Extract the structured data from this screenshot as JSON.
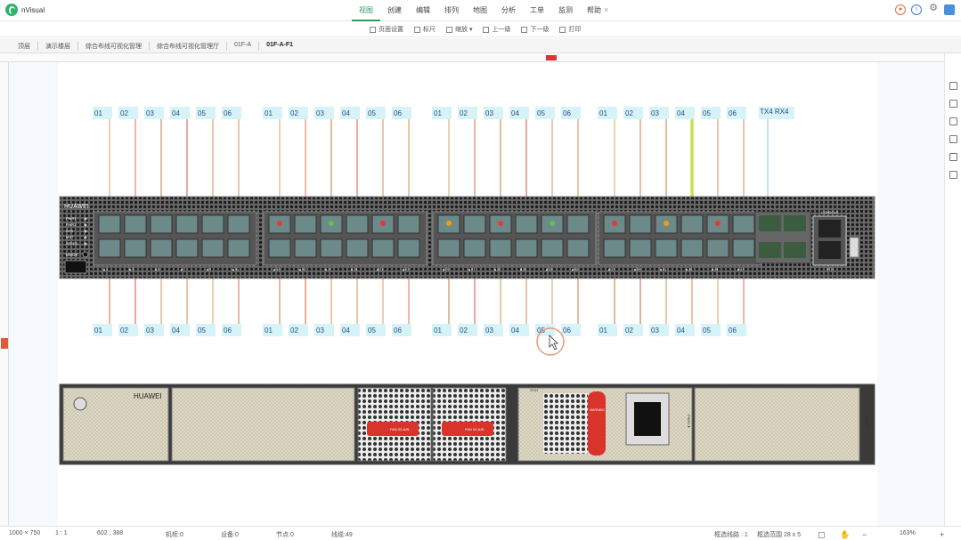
{
  "app": {
    "name": "nVisual"
  },
  "menu": [
    {
      "label": "视图",
      "active": true
    },
    {
      "label": "创建"
    },
    {
      "label": "编辑"
    },
    {
      "label": "排列"
    },
    {
      "label": "地图"
    },
    {
      "label": "分析"
    },
    {
      "label": "工单"
    },
    {
      "label": "监测"
    },
    {
      "label": "帮助"
    }
  ],
  "toolbar": [
    {
      "label": "页面设置"
    },
    {
      "label": "标尺"
    },
    {
      "label": "缩放 ▾"
    },
    {
      "label": "上一级"
    },
    {
      "label": "下一级"
    },
    {
      "label": "打印"
    }
  ],
  "breadcrumb": [
    "顶层",
    "演示楼层",
    "综合布线可视化管理",
    "综合布线可视化管理厅",
    "01F-A",
    "01F-A-F1"
  ],
  "device1": {
    "brand": "HUAWEI",
    "leds": [
      "PWR1",
      "PWR2",
      "SYS",
      "MST",
      "SPEED"
    ],
    "mode_label": "MODE",
    "console_label": "CONSOLE",
    "eth_label": "ETH",
    "port_numbers": [
      "1",
      "3",
      "5",
      "7",
      "9",
      "11",
      "13",
      "15",
      "17",
      "19",
      "21",
      "23",
      "25",
      "27",
      "29",
      "31",
      "33",
      "35",
      "37",
      "39",
      "41",
      "43",
      "45",
      "47"
    ],
    "top_row_numbers": [
      "2",
      "4",
      "6",
      "8",
      "10",
      "12",
      "14",
      "16",
      "18",
      "20",
      "22",
      "24",
      "26",
      "28",
      "30",
      "32",
      "34",
      "36",
      "38",
      "40",
      "42",
      "44",
      "46",
      "48"
    ]
  },
  "device2": {
    "brand": "HUAWEI",
    "fan_labels": [
      "FAN\n02-A/B",
      "FAN\n02-A/B"
    ],
    "slot_labels": [
      "STAT",
      "PWR1▼",
      "PWR2▼"
    ],
    "warning": "WARNING"
  },
  "cable_labels_top": [
    "01",
    "02",
    "03",
    "04",
    "05",
    "06",
    "01",
    "02",
    "03",
    "04",
    "05",
    "06",
    "01",
    "02",
    "03",
    "04",
    "05",
    "06",
    "01",
    "02",
    "03",
    "04",
    "05",
    "06"
  ],
  "tx_rx_label": "TX4 RX4",
  "cable_labels_bottom": [
    "01",
    "02",
    "03",
    "04",
    "05",
    "06",
    "01",
    "02",
    "03",
    "04",
    "05",
    "06",
    "01",
    "02",
    "03",
    "04",
    "05",
    "06",
    "01",
    "02",
    "03",
    "04",
    "05",
    "06"
  ],
  "status": {
    "page_size": "1000 × 750",
    "scale": "1 : 1",
    "coords": "602 , 388",
    "cabinets": "机柜:0",
    "devices": "设备:0",
    "nodes": "节点:0",
    "lines": "线缆:49",
    "selected_lines": "框选线路 : 1",
    "selected_range": "框选范围 28 x 5",
    "zoom": "163%"
  },
  "colors": {
    "accent": "#2f9c5c",
    "cable_label_bg": "#d6f3f7",
    "device_body": "#3a3a3a",
    "port_green": "#5fc24f"
  }
}
